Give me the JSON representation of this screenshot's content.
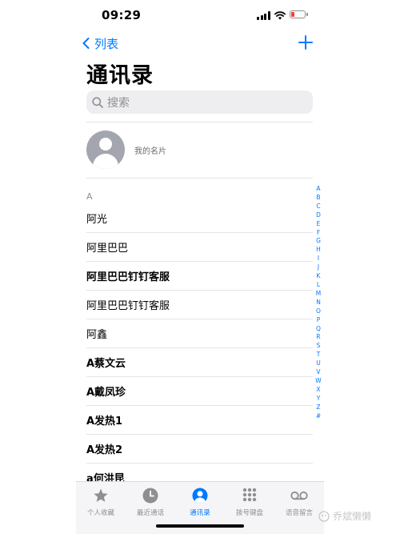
{
  "status_bar": {
    "time": "09:29",
    "battery_color": "#ff3b30"
  },
  "nav": {
    "back_label": "列表",
    "title": "通讯录"
  },
  "search": {
    "placeholder": "搜索"
  },
  "my_card": {
    "label": "我的名片"
  },
  "section_header": "A",
  "contacts": [
    {
      "name": "阿光",
      "bold": false
    },
    {
      "name": "阿里巴巴",
      "bold": false
    },
    {
      "name": "阿里巴巴钉钉客服",
      "bold": true
    },
    {
      "name": "阿里巴巴钉钉客服",
      "bold": false
    },
    {
      "name": "阿鑫",
      "bold": false
    },
    {
      "name": "A蔡文云",
      "bold": true
    },
    {
      "name": "A戴凤珍",
      "bold": true
    },
    {
      "name": "A发热1",
      "bold": true
    },
    {
      "name": "A发热2",
      "bold": true
    },
    {
      "name": "a何洪昆",
      "bold": true
    }
  ],
  "index_letters": [
    "A",
    "B",
    "C",
    "D",
    "E",
    "F",
    "G",
    "H",
    "I",
    "J",
    "K",
    "L",
    "M",
    "N",
    "O",
    "P",
    "Q",
    "R",
    "S",
    "T",
    "U",
    "V",
    "W",
    "X",
    "Y",
    "Z",
    "#"
  ],
  "tabs": [
    {
      "label": "个人收藏",
      "icon": "star-icon",
      "active": false
    },
    {
      "label": "最近通话",
      "icon": "clock-icon",
      "active": false
    },
    {
      "label": "通讯录",
      "icon": "contact-icon",
      "active": true
    },
    {
      "label": "拨号键盘",
      "icon": "keypad-icon",
      "active": false
    },
    {
      "label": "语音留言",
      "icon": "voicemail-icon",
      "active": false
    }
  ],
  "watermark": {
    "text": "乔斌懒懒"
  },
  "colors": {
    "accent": "#007aff",
    "inactive": "#8e8e93",
    "tabbar_bg": "#f5f5f7"
  }
}
